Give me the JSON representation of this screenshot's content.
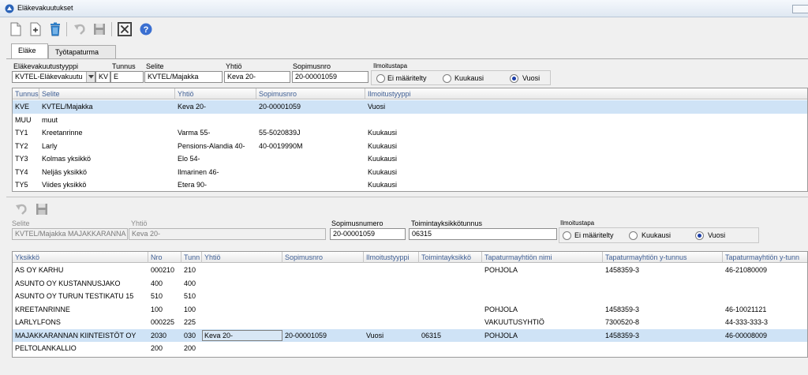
{
  "window": {
    "title": "Eläkevakuutukset"
  },
  "tabs": [
    {
      "label": "Eläke",
      "active": true
    },
    {
      "label": "Työtapaturma",
      "active": false
    }
  ],
  "upper_form": {
    "type_label": "Eläkevakuutustyyppi",
    "type_value": "KVTEL-Eläkevakuutu",
    "code_label": "Tunnus",
    "code_prefix": "KV",
    "code_value": "E",
    "desc_label": "Selite",
    "desc_value": "KVTEL/Majakka",
    "company_label": "Yhtiö",
    "company_value": "Keva 20-",
    "contract_label": "Sopimusnro",
    "contract_value": "20-00001059",
    "reporting_label": "Ilmoitustapa",
    "reporting_options": [
      "Ei määritelty",
      "Kuukausi",
      "Vuosi"
    ],
    "reporting_selected": "Vuosi"
  },
  "upper_grid": {
    "columns": [
      "Tunnus",
      "Selite",
      "Yhtiö",
      "Sopimusnro",
      "Ilmoitustyyppi"
    ],
    "rows": [
      [
        "KVE",
        "KVTEL/Majakka",
        "Keva 20-",
        "20-00001059",
        "Vuosi"
      ],
      [
        "MUU",
        "muut",
        "",
        "",
        ""
      ],
      [
        "TY1",
        "Kreetanrinne",
        "Varma 55-",
        "55-5020839J",
        "Kuukausi"
      ],
      [
        "TY2",
        "Larly",
        "Pensions-Alandia 40-",
        "40-0019990M",
        "Kuukausi"
      ],
      [
        "TY3",
        "Kolmas yksikkö",
        "Elo 54-",
        "",
        "Kuukausi"
      ],
      [
        "TY4",
        "Neljäs yksikkö",
        "Ilmarinen 46-",
        "",
        "Kuukausi"
      ],
      [
        "TY5",
        "Viides yksikkö",
        "Etera 90-",
        "",
        "Kuukausi"
      ]
    ],
    "selected_row": 0
  },
  "lower_form": {
    "desc_label": "Selite",
    "desc_value": "KVTEL/Majakka MAJAKKARANNA",
    "company_label": "Yhtiö",
    "company_value": "Keva 20-",
    "contract_label": "Sopimusnumero",
    "contract_value": "20-00001059",
    "office_label": "Toimintayksikkötunnus",
    "office_value": "06315",
    "reporting_label": "Ilmoitustapa",
    "reporting_options": [
      "Ei määritelty",
      "Kuukausi",
      "Vuosi"
    ],
    "reporting_selected": "Vuosi"
  },
  "lower_grid": {
    "columns": [
      "Yksikkö",
      "Nro",
      "Tunn",
      "Yhtiö",
      "Sopimusnro",
      "Ilmoitustyyppi",
      "Toimintayksikkö",
      "Tapaturmayhtiön nimi",
      "Tapaturmayhtiön y-tunnus",
      "Tapaturmayhtiön y-tunn"
    ],
    "rows": [
      [
        "AS OY KARHU",
        "000210",
        "210",
        "",
        "",
        "",
        "",
        "POHJOLA",
        "1458359-3",
        "46-21080009"
      ],
      [
        "ASUNTO OY KUSTANNUSJAKO",
        "400",
        "400",
        "",
        "",
        "",
        "",
        "",
        "",
        ""
      ],
      [
        "ASUNTO OY TURUN TESTIKATU 15",
        "510",
        "510",
        "",
        "",
        "",
        "",
        "",
        "",
        ""
      ],
      [
        "KREETANRINNE",
        "100",
        "100",
        "",
        "",
        "",
        "",
        "POHJOLA",
        "1458359-3",
        "46-10021121"
      ],
      [
        "LARLYLFONS",
        "000225",
        "225",
        "",
        "",
        "",
        "",
        "VAKUUTUSYHTIÖ",
        "7300520-8",
        "44-333-333-3"
      ],
      [
        "MAJAKKARANNAN KIINTEISTÖT OY",
        "2030",
        "030",
        "Keva 20-",
        "20-00001059",
        "Vuosi",
        "06315",
        "POHJOLA",
        "1458359-3",
        "46-00008009"
      ],
      [
        "PELTOLANKALLIO",
        "200",
        "200",
        "",
        "",
        "",
        "",
        "",
        "",
        ""
      ]
    ],
    "selected_row": 5
  },
  "icons": {
    "toolbar": [
      "new-document-icon",
      "add-icon",
      "delete-icon",
      "undo-icon",
      "save-icon",
      "close-icon",
      "help-icon"
    ],
    "toolbar2": [
      "undo-icon",
      "save-icon"
    ]
  },
  "colors": {
    "selection": "#cfe3f6",
    "header_text": "#3e5e94",
    "radio_dot": "#1d3fa8"
  }
}
